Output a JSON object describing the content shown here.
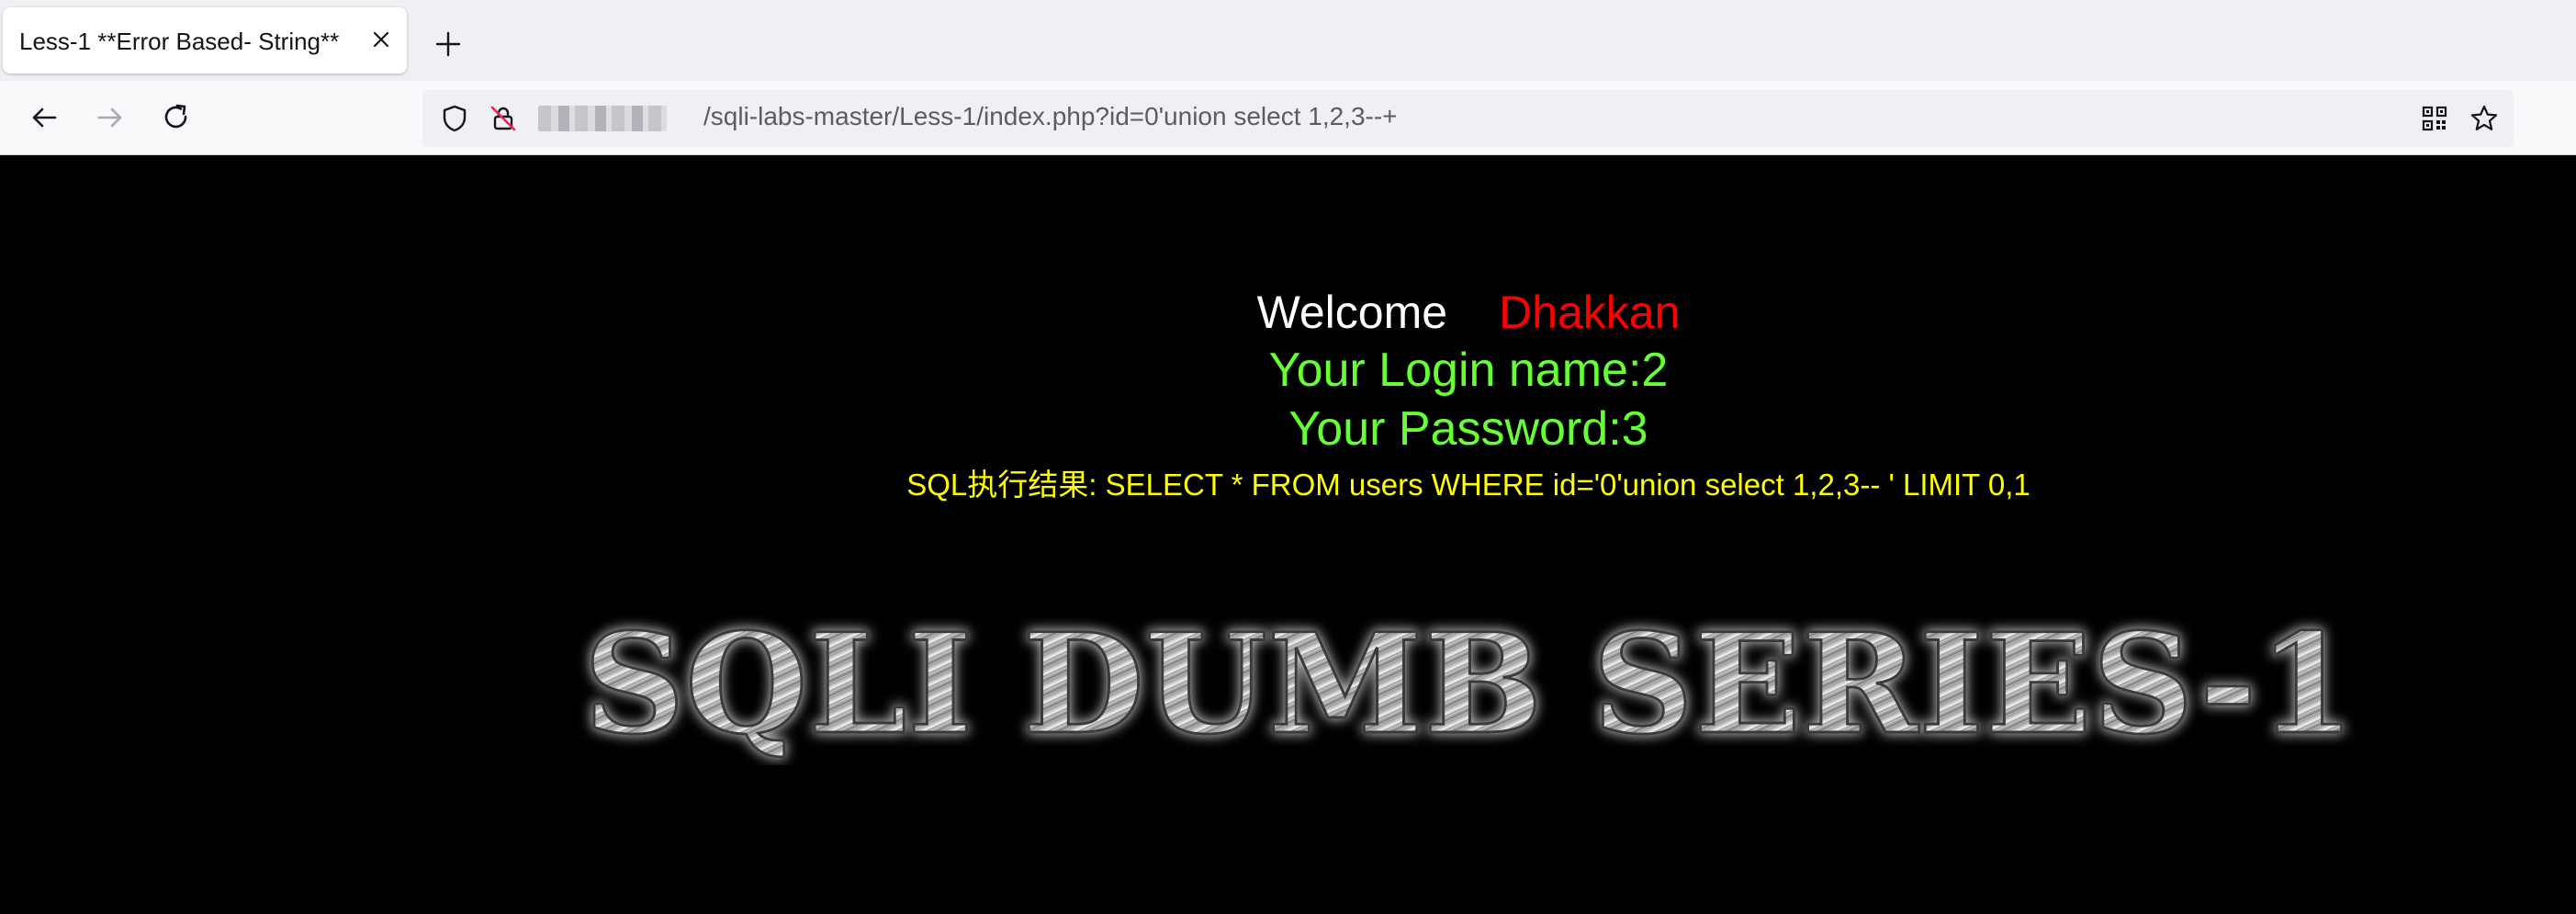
{
  "browser": {
    "tab_title": "Less-1 **Error Based- String**",
    "url_path": "/sqli-labs-master/Less-1/index.php?id=0'union select 1,2,3--+",
    "icons": {
      "tab_close": "close-icon",
      "new_tab": "plus-icon",
      "back": "arrow-left-icon",
      "forward": "arrow-right-icon",
      "reload": "reload-icon",
      "tracking_protection": "shield-icon",
      "insecure": "insecure-lock-icon",
      "qr_code": "qr-code-icon",
      "bookmark": "star-icon"
    }
  },
  "page": {
    "welcome_label": "Welcome",
    "welcome_name": "Dhakkan",
    "login_name_text": "Your Login name:2",
    "password_text": "Your Password:3",
    "sql_text": "SQL执行结果: SELECT * FROM users WHERE id='0'union select 1,2,3-- ' LIMIT 0,1",
    "banner_text": "SQLI DUMB SERIES-1"
  },
  "colors": {
    "page_background": "#000000",
    "welcome_label": "#ffffff",
    "welcome_name": "#ff0000",
    "login_info": "#66ff33",
    "sql_text": "#ffff00"
  }
}
